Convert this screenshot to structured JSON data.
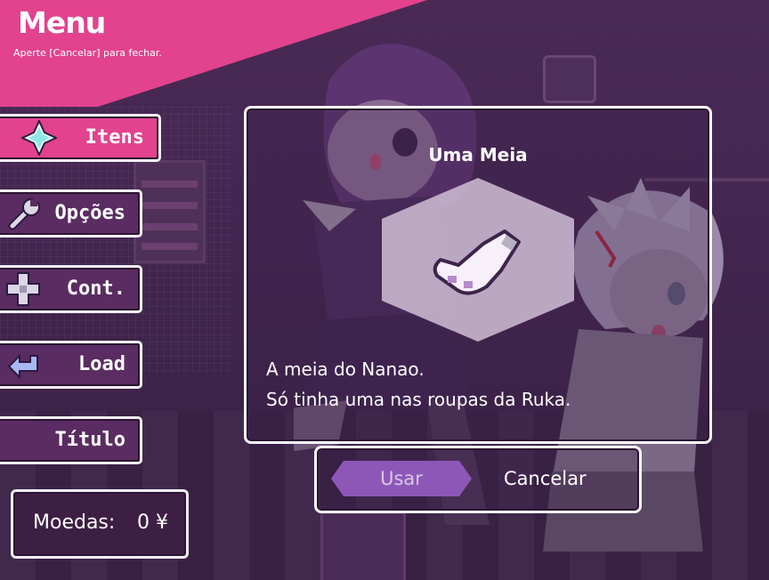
{
  "header": {
    "title": "Menu",
    "subtitle": "Aperte [Cancelar] para fechar."
  },
  "menu": {
    "items": [
      {
        "label": "Itens",
        "icon": "diamond-star-icon",
        "active": true
      },
      {
        "label": "Opções",
        "icon": "wrench-icon",
        "active": false
      },
      {
        "label": "Cont.",
        "icon": "dpad-icon",
        "active": false
      },
      {
        "label": "Load",
        "icon": "return-arrow-icon",
        "active": false
      },
      {
        "label": "Título",
        "icon": "",
        "active": false
      }
    ]
  },
  "coins": {
    "label": "Moedas:",
    "value": "0 ¥"
  },
  "item": {
    "name": "Uma Meia",
    "icon": "sock-icon",
    "description_line1": "A meia do Nanao.",
    "description_line2": "Só tinha uma nas roupas da Ruka."
  },
  "actions": {
    "use_label": "Usar",
    "cancel_label": "Cancelar"
  },
  "colors": {
    "header_pink": "#e2428e",
    "active_item": "#e2428e",
    "menu_button": "#5a2c62",
    "use_button": "#8d57b8",
    "background": "#3a2244"
  }
}
